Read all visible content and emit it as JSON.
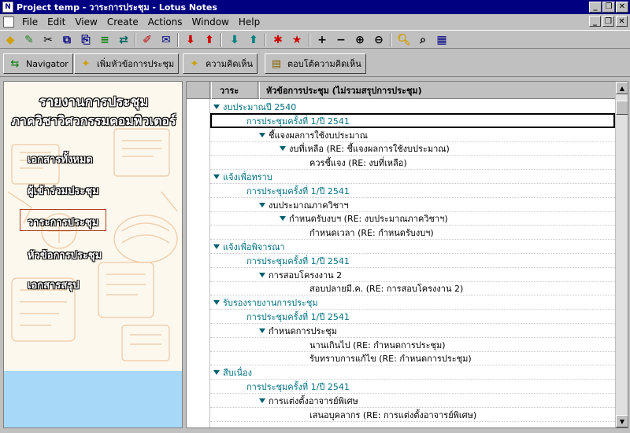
{
  "window": {
    "title": "Project temp - วาระการประชุม - Lotus Notes"
  },
  "menu": [
    {
      "label": "File"
    },
    {
      "label": "Edit"
    },
    {
      "label": "View"
    },
    {
      "label": "Create"
    },
    {
      "label": "Actions"
    },
    {
      "label": "Window"
    },
    {
      "label": "Help"
    }
  ],
  "action_buttons": [
    {
      "label": "Navigator",
      "icon": "navigator-icon"
    },
    {
      "label": "เพิ่มหัวข้อการประชุม",
      "icon": "add-topic-icon"
    },
    {
      "label": "ความคิดเห็น",
      "icon": "comment-icon"
    },
    {
      "label": "ตอบโต้ความคิดเห็น",
      "icon": "reply-icon"
    }
  ],
  "navigator": {
    "title_line1": "รายงานการประชุม",
    "title_line2": "ภาควิชาวิศวกรรมคอมพิวเตอร์",
    "items": [
      {
        "label": "เอกสารทั้งหมด"
      },
      {
        "label": "ผู้เข้าร่วมประชุม"
      },
      {
        "label": "วาระการประชุม",
        "selected": true
      },
      {
        "label": "หัวข้อการประชุม"
      },
      {
        "label": "เอกสารสรุป"
      }
    ]
  },
  "view": {
    "columns": [
      "วาระ",
      "หัวข้อการประชุม (ไม่รวมสรุปการประชุม)"
    ],
    "rows": [
      {
        "level": 0,
        "text": "งบประมาณปี 2540",
        "twisty": true,
        "teal": true
      },
      {
        "level": 1,
        "text": "การประชุมครั้งที่ 1/ปี 2541",
        "twisty": false,
        "teal": true,
        "selected": true
      },
      {
        "level": 2,
        "text": "ชี้แจงผลการใช้งบประมาณ",
        "twisty": true,
        "teal": false
      },
      {
        "level": 3,
        "text": "งบที่เหลือ (RE: ชี้แจงผลการใช้งบประมาณ)",
        "twisty": true,
        "teal": false
      },
      {
        "level": 4,
        "text": "ควรชี้แจง (RE: งบที่เหลือ)",
        "twisty": false,
        "teal": false
      },
      {
        "level": 0,
        "text": "แจ้งเพื่อทราบ",
        "twisty": true,
        "teal": true
      },
      {
        "level": 1,
        "text": "การประชุมครั้งที่ 1/ปี 2541",
        "twisty": false,
        "teal": true
      },
      {
        "level": 2,
        "text": "งบประมาณภาควิชาฯ",
        "twisty": true,
        "teal": false
      },
      {
        "level": 3,
        "text": "กำหนดรับงบฯ (RE: งบประมาณภาควิชาฯ)",
        "twisty": true,
        "teal": false
      },
      {
        "level": 4,
        "text": "กำหนดเวลา (RE: กำหนดรับงบฯ)",
        "twisty": false,
        "teal": false
      },
      {
        "level": 0,
        "text": "แจ้งเพื่อพิจารณา",
        "twisty": true,
        "teal": true
      },
      {
        "level": 1,
        "text": "การประชุมครั้งที่ 1/ปี 2541",
        "twisty": false,
        "teal": true
      },
      {
        "level": 2,
        "text": "การสอบโครงงาน 2",
        "twisty": true,
        "teal": false
      },
      {
        "level": 4,
        "text": "สอบปลายมี.ค. (RE: การสอบโครงงาน 2)",
        "twisty": false,
        "teal": false
      },
      {
        "level": 0,
        "text": "รับรองรายงานการประชุม",
        "twisty": true,
        "teal": true
      },
      {
        "level": 1,
        "text": "การประชุมครั้งที่ 1/ปี 2541",
        "twisty": false,
        "teal": true
      },
      {
        "level": 2,
        "text": "กำหนดการประชุม",
        "twisty": true,
        "teal": false
      },
      {
        "level": 4,
        "text": "นานเกินไป (RE: กำหนดการประชุม)",
        "twisty": false,
        "teal": false
      },
      {
        "level": 4,
        "text": "รับทราบการแก้ไข (RE: กำหนดการประชุม)",
        "twisty": false,
        "teal": false
      },
      {
        "level": 0,
        "text": "สืบเนื่อง",
        "twisty": true,
        "teal": true
      },
      {
        "level": 1,
        "text": "การประชุมครั้งที่ 1/ปี 2541",
        "twisty": false,
        "teal": true
      },
      {
        "level": 2,
        "text": "การแต่งตั้งอาจารย์พิเศษ",
        "twisty": true,
        "teal": false
      },
      {
        "level": 4,
        "text": "เสนอบุคลากร (RE: การแต่งตั้งอาจารย์พิเศษ)",
        "twisty": false,
        "teal": false
      }
    ]
  }
}
